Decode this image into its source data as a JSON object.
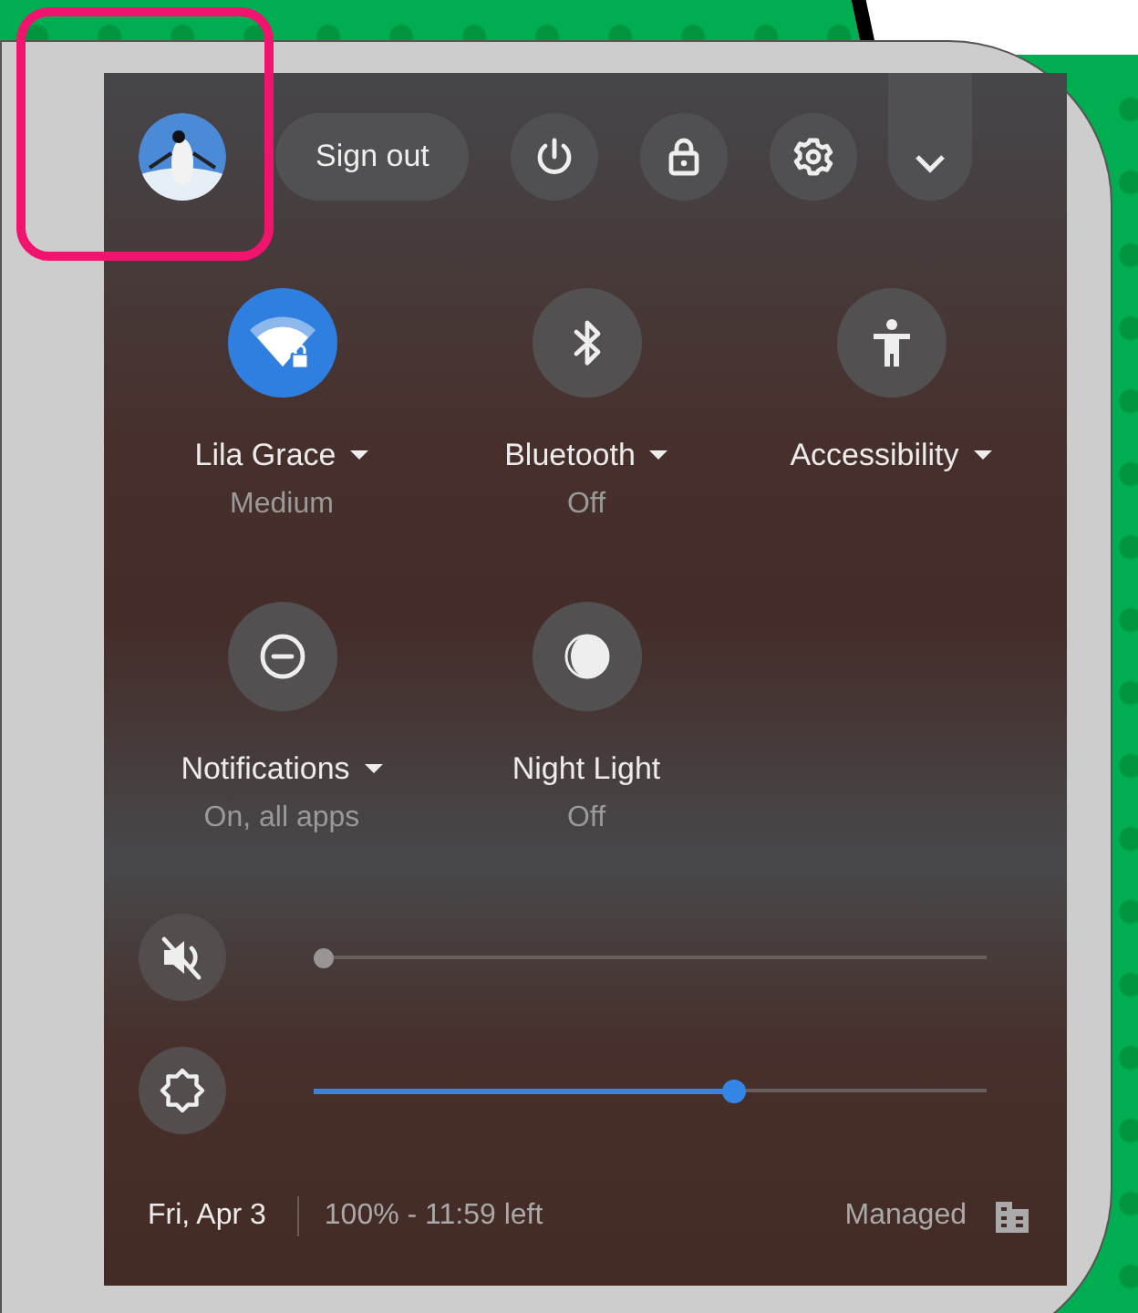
{
  "top_bar": {
    "sign_out": "Sign out",
    "buttons": [
      {
        "kind": "power"
      },
      {
        "kind": "lock"
      },
      {
        "kind": "settings"
      }
    ]
  },
  "tiles": [
    {
      "kind": "wifi",
      "label": "Lila Grace",
      "sublabel": "Medium",
      "on": true,
      "has_menu": true
    },
    {
      "kind": "bluetooth",
      "label": "Bluetooth",
      "sublabel": "Off",
      "on": false,
      "has_menu": true
    },
    {
      "kind": "accessibility",
      "label": "Accessibility",
      "on": false,
      "has_menu": true
    },
    {
      "kind": "notifications",
      "label": "Notifications",
      "sublabel": "On, all apps",
      "on": false,
      "has_menu": true
    },
    {
      "kind": "night_light",
      "label": "Night Light",
      "sublabel": "Off",
      "on": false,
      "has_menu": false
    }
  ],
  "sliders": [
    {
      "kind": "volume",
      "muted": true,
      "level": 0
    },
    {
      "kind": "brightness",
      "level": 0.63
    }
  ],
  "footer": {
    "date": "Fri, Apr 3",
    "battery": "100% - 11:59 left",
    "managed": "Managed"
  }
}
